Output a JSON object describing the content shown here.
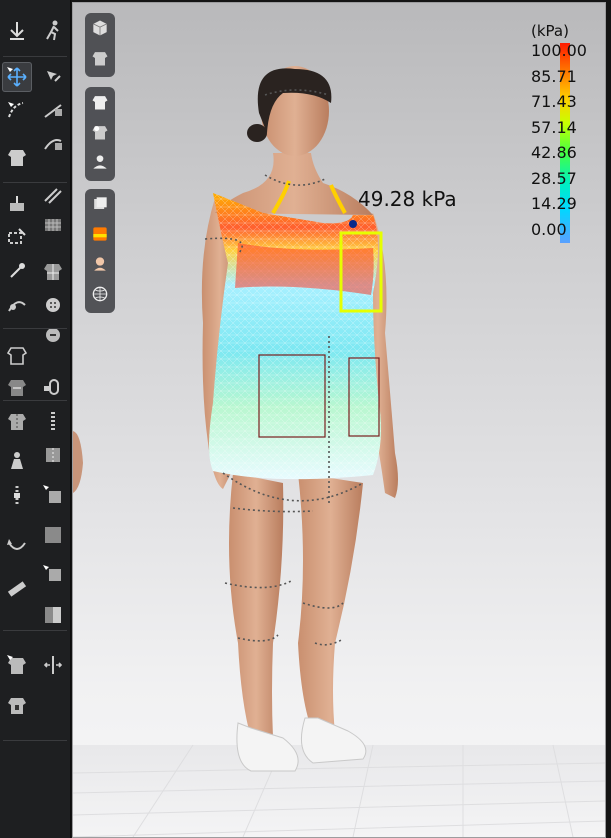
{
  "toolbar": {
    "left_column": [
      {
        "name": "arrange-down-icon",
        "active": false
      },
      {
        "name": "transform-pattern-icon",
        "active": true
      },
      {
        "name": "fold-arrangement-icon",
        "active": false
      },
      {
        "name": "garment-select-icon",
        "active": false
      },
      {
        "name": "tack-icon",
        "active": false
      },
      {
        "name": "edit-pattern-icon",
        "active": false
      },
      {
        "name": "pin-icon",
        "active": false
      },
      {
        "name": "measure-icon",
        "active": false
      },
      {
        "name": "shirt-outline-icon",
        "active": false
      },
      {
        "name": "shirt-pattern-icon",
        "active": false
      },
      {
        "name": "shirt-stitch-icon",
        "active": false
      },
      {
        "name": "avatar-pose-icon",
        "active": false
      },
      {
        "name": "zipper-icon",
        "active": false
      },
      {
        "name": "bend-icon",
        "active": false
      },
      {
        "name": "ruler-icon",
        "active": false
      },
      {
        "name": "shirt-select-icon",
        "active": false
      },
      {
        "name": "shirt-tag-icon",
        "active": false
      }
    ],
    "right_column": [
      {
        "name": "walk-icon"
      },
      {
        "name": "select-move-icon"
      },
      {
        "name": "sew-segment-icon"
      },
      {
        "name": "sew-free-icon"
      },
      {
        "name": "sew-multi-icon"
      },
      {
        "name": "texture-pattern-icon"
      },
      {
        "name": "fabric-grid-icon"
      },
      {
        "name": "button-icon"
      },
      {
        "name": "button-hole-icon"
      },
      {
        "name": "buttonhole-lock-icon"
      },
      {
        "name": "zipper-pull-icon"
      },
      {
        "name": "puckering-icon"
      },
      {
        "name": "graphic-icon"
      },
      {
        "name": "panel-icon"
      },
      {
        "name": "fold-icon"
      },
      {
        "name": "layer-icon"
      },
      {
        "name": "width-adjust-icon"
      }
    ]
  },
  "viewport_toolbar": {
    "group1": [
      {
        "name": "cube-view-icon"
      },
      {
        "name": "garment-view-icon"
      }
    ],
    "group2": [
      {
        "name": "shirt-display-icon"
      },
      {
        "name": "texture-display-icon"
      },
      {
        "name": "avatar-display-icon"
      }
    ],
    "group3": [
      {
        "name": "layers-display-icon"
      },
      {
        "name": "stress-map-icon"
      },
      {
        "name": "skin-display-icon"
      },
      {
        "name": "globe-icon"
      }
    ]
  },
  "legend": {
    "unit": "(kPa)",
    "ticks": [
      "100.00",
      "85.71",
      "71.43",
      "57.14",
      "42.86",
      "28.57",
      "14.29",
      "0.00"
    ]
  },
  "readout": {
    "value": "49.28 kPa"
  },
  "colors": {
    "toolbar_bg": "#1e1f21",
    "viewport_bg_top": "#b9b9bb",
    "viewport_bg_bottom": "#f7f7f8",
    "accent_blue": "#3aa0ff"
  }
}
